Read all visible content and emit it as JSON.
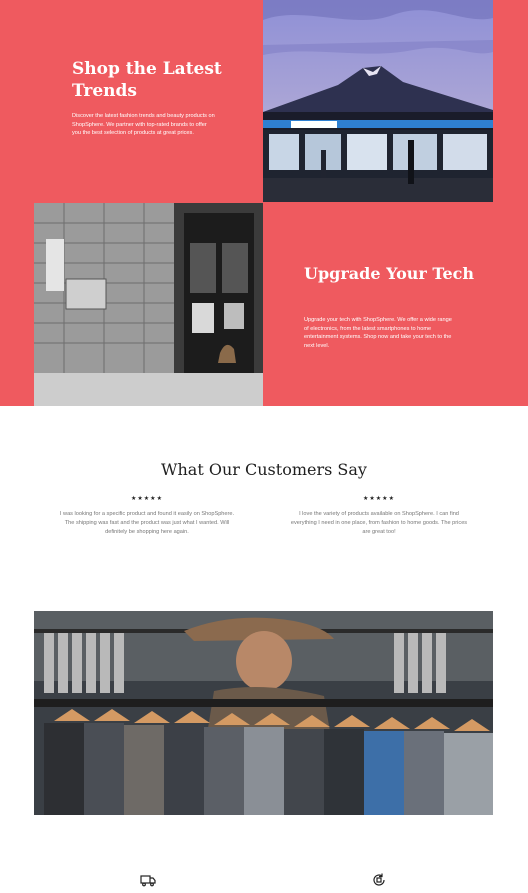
{
  "section1": {
    "title": "Shop the Latest Trends",
    "text": "Discover the latest fashion trends and beauty products on ShopSphere. We partner with top-rated brands to offer you the best selection of products at great prices.",
    "image_icon": "store-street-photo"
  },
  "section2": {
    "title": "Upgrade Your Tech",
    "text": "Upgrade your tech with ShopSphere. We offer a wide range of electronics, from the latest smartphones to home entertainment systems. Shop now and take your tech to the next level.",
    "image_icon": "urban-doorway-photo"
  },
  "testimonials": {
    "title": "What Our Customers Say",
    "items": [
      {
        "stars": "★★★★★",
        "text": "I was looking for a specific product and found it easily on ShopSphere. The shipping was fast and the product was just what I wanted. Will definitely be shopping here again."
      },
      {
        "stars": "★★★★★",
        "text": "I love the variety of products available on ShopSphere. I can find everything I need in one place, from fashion to home goods. The prices are great too!"
      }
    ]
  },
  "banner": {
    "image_icon": "clothing-rack-photo"
  },
  "features": {
    "icons": [
      "truck-icon",
      "return-icon"
    ]
  },
  "colors": {
    "accent": "#ef5a5f",
    "dark": "#1f1f1f",
    "muted": "#777777"
  }
}
